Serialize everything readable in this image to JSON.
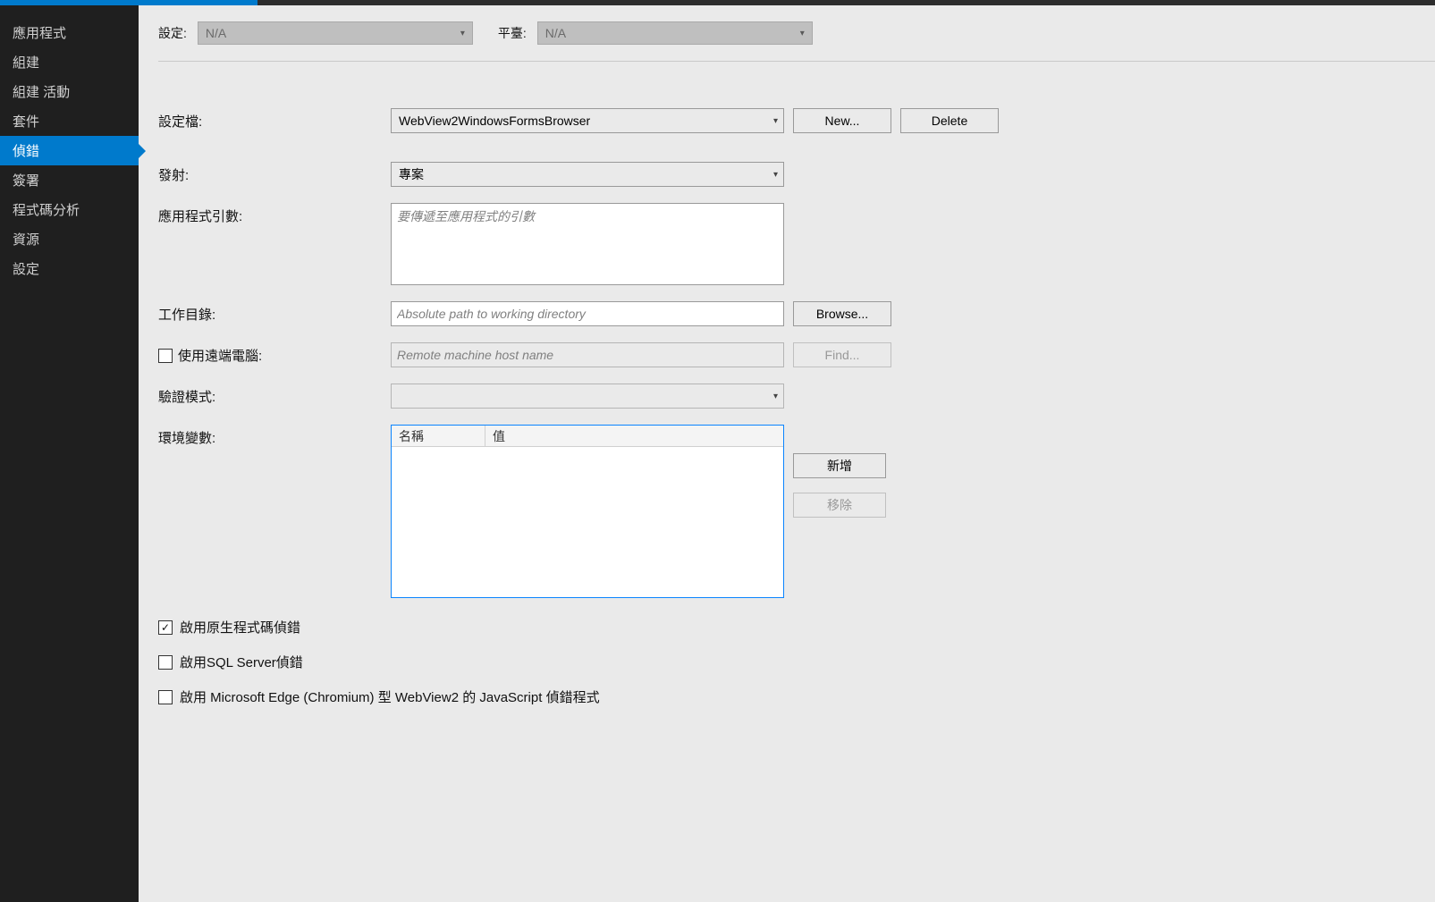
{
  "sidebar": {
    "items": [
      {
        "label": "應用程式"
      },
      {
        "label": "組建"
      },
      {
        "label": "組建 活動"
      },
      {
        "label": "套件"
      },
      {
        "label": "偵錯"
      },
      {
        "label": "簽署"
      },
      {
        "label": "程式碼分析"
      },
      {
        "label": "資源"
      },
      {
        "label": "設定"
      }
    ],
    "active_index": 4
  },
  "header": {
    "config_label": "設定:",
    "config_value": "N/A",
    "platform_label": "平臺:",
    "platform_value": "N/A"
  },
  "form": {
    "profile_label": "設定檔:",
    "profile_value": "WebView2WindowsFormsBrowser",
    "new_button": "New...",
    "delete_button": "Delete",
    "launch_label": "發射:",
    "launch_value": "專案",
    "app_args_label": "應用程式引數:",
    "app_args_placeholder": "要傳遞至應用程式的引數",
    "working_dir_label": "工作目錄:",
    "working_dir_placeholder": "Absolute path to working directory",
    "browse_button": "Browse...",
    "remote_checkbox_label": "使用遠端電腦:",
    "remote_placeholder": "Remote machine host name",
    "find_button": "Find...",
    "auth_mode_label": "驗證模式:",
    "env_vars_label": "環境變數:",
    "env_col_name": "名稱",
    "env_col_value": "值",
    "add_button": "新增",
    "remove_button": "移除"
  },
  "bottom_checks": {
    "native_debug": {
      "label": "啟用原生程式碼偵錯",
      "checked": true
    },
    "sql_debug": {
      "label": "啟用SQL Server偵錯",
      "checked": false
    },
    "js_debug": {
      "label": "啟用 Microsoft Edge (Chromium) 型 WebView2 的 JavaScript 偵錯程式",
      "checked": false
    }
  }
}
